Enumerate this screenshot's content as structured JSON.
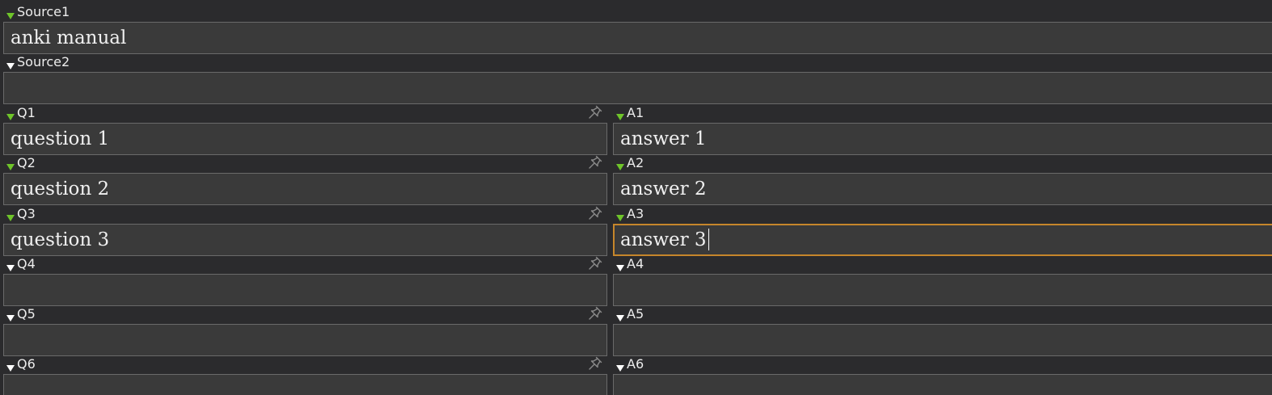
{
  "fields": {
    "source1": {
      "label": "Source1",
      "value": "anki manual"
    },
    "source2": {
      "label": "Source2",
      "value": ""
    },
    "q1": {
      "label": "Q1",
      "value": "question 1"
    },
    "a1": {
      "label": "A1",
      "value": "answer 1"
    },
    "q2": {
      "label": "Q2",
      "value": "question 2"
    },
    "a2": {
      "label": "A2",
      "value": "answer 2"
    },
    "q3": {
      "label": "Q3",
      "value": "question 3"
    },
    "a3": {
      "label": "A3",
      "value": "answer 3"
    },
    "q4": {
      "label": "Q4",
      "value": ""
    },
    "a4": {
      "label": "A4",
      "value": ""
    },
    "q5": {
      "label": "Q5",
      "value": ""
    },
    "a5": {
      "label": "A5",
      "value": ""
    },
    "q6": {
      "label": "Q6",
      "value": ""
    },
    "a6": {
      "label": "A6",
      "value": ""
    }
  },
  "icons": {
    "collapse": "chevron-down-icon",
    "sticky": "pin-icon"
  },
  "colors": {
    "background": "#2b2b2d",
    "field_bg": "#3a3a3a",
    "field_border": "#6a6a6a",
    "focus_border": "#c6862b",
    "arrow_filled": "#6fc52a",
    "arrow_empty": "#ffffff"
  }
}
